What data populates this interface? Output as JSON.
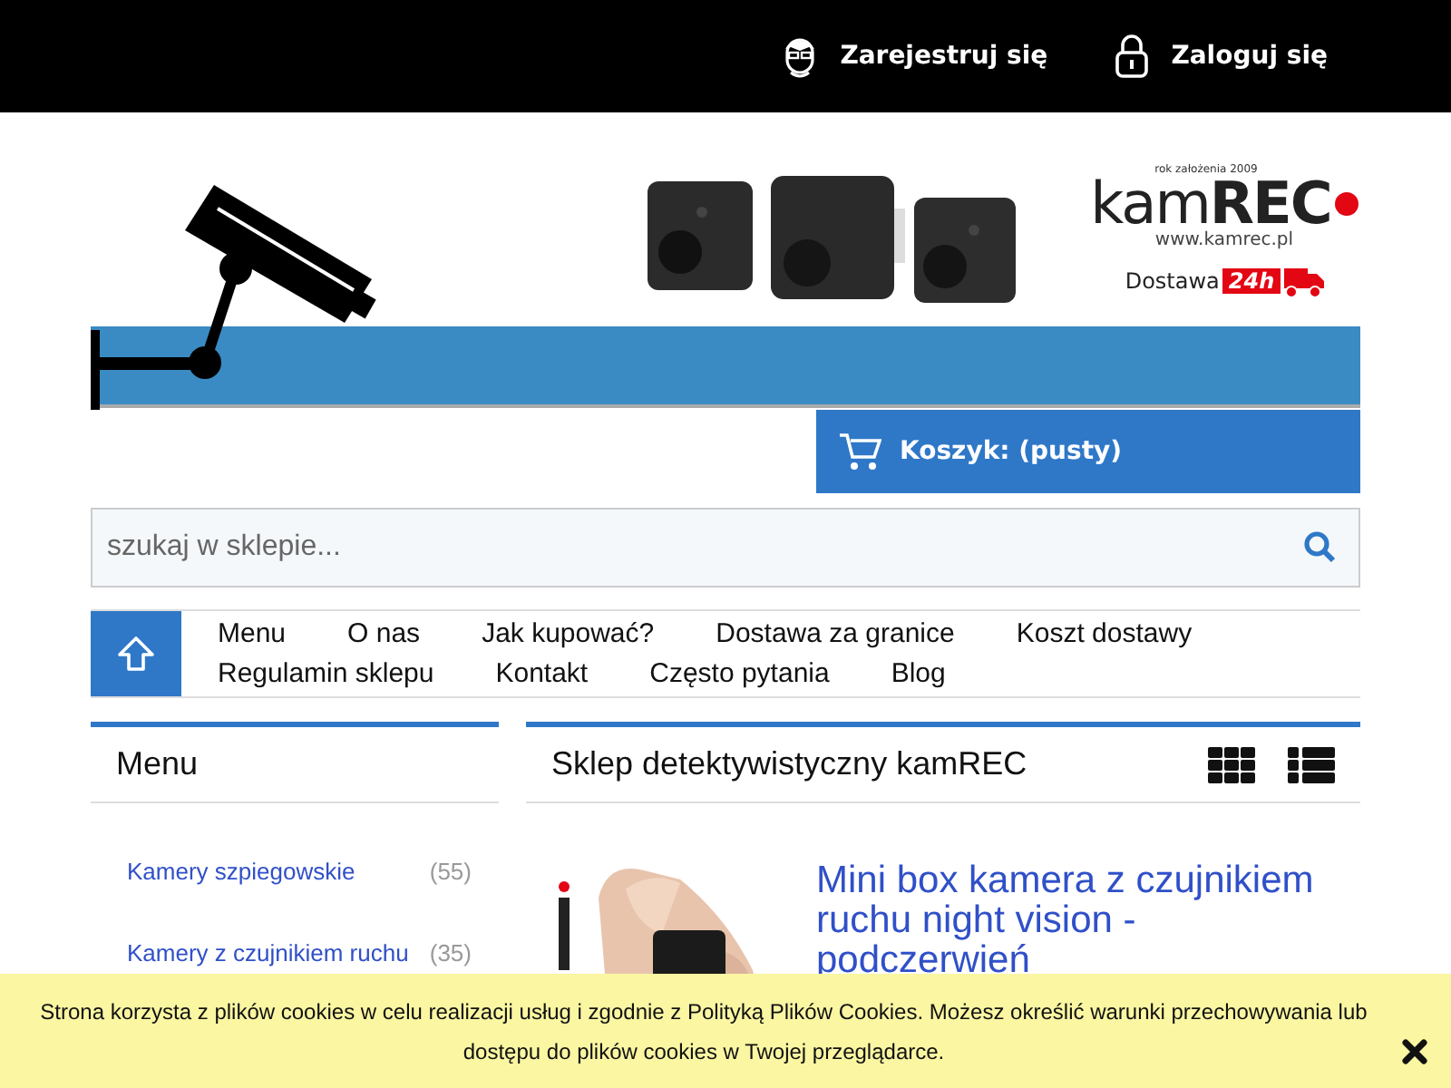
{
  "top_links": [
    {
      "kind": "register",
      "label": "Zarejestruj się"
    },
    {
      "kind": "login",
      "label": "Zaloguj się"
    }
  ],
  "logo": {
    "tagline": "rok założenia 2009",
    "name_light": "kam",
    "name_bold": "REC",
    "url": "www.kamrec.pl",
    "delivery": "Dostawa",
    "delivery_badge": "24h"
  },
  "cart": {
    "label": "Koszyk: (pusty)"
  },
  "search": {
    "placeholder": "szukaj w sklepie..."
  },
  "nav": {
    "items": [
      "Menu",
      "O nas",
      "Jak kupować?",
      "Dostawa za granice",
      "Koszt dostawy",
      "Regulamin sklepu",
      "Kontakt",
      "Często pytania",
      "Blog"
    ]
  },
  "sidebar": {
    "title": "Menu",
    "items": [
      {
        "label": "Kamery szpiegowskie",
        "count": "(55)"
      },
      {
        "label": "Kamery z czujnikiem ruchu",
        "count": "(35)"
      }
    ]
  },
  "main": {
    "title": "Sklep detektywistyczny kamREC",
    "views": [
      {
        "kind": "grid"
      },
      {
        "kind": "list"
      }
    ],
    "products": [
      {
        "title": "Mini box kamera z czujnikiem ruchu night vision - podczerwień",
        "kind": "picture"
      }
    ]
  },
  "cookie": {
    "text": "Strona korzysta z plików cookies w celu realizacji usług i zgodnie z Polityką Plików Cookies. Możesz określić warunki przechowywania lub dostępu do plików cookies w Twojej przeglądarce."
  }
}
